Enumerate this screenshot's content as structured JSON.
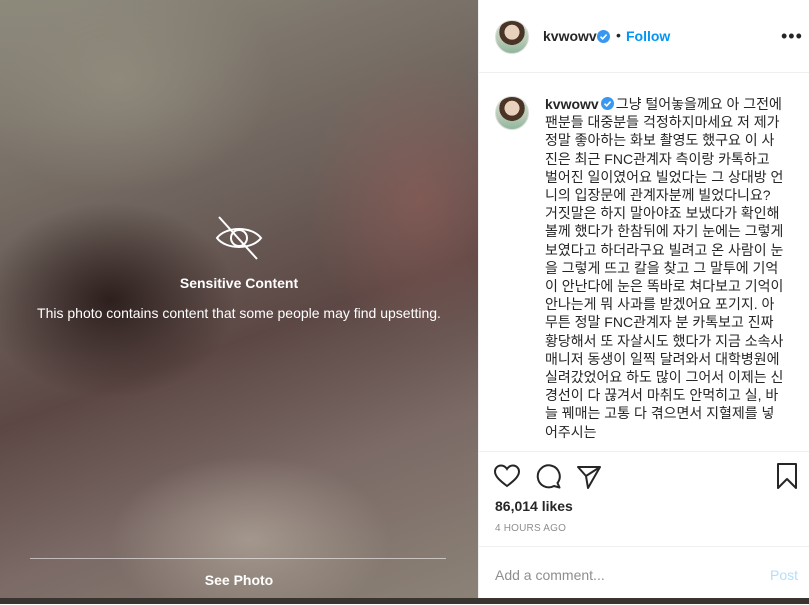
{
  "media": {
    "icon": "eye-slash-icon",
    "title": "Sensitive Content",
    "description": "This photo contains content that some people may find upsetting.",
    "see_photo": "See Photo"
  },
  "header": {
    "username": "kvwowv",
    "verified_icon": "verified-badge-icon",
    "separator": "•",
    "follow": "Follow",
    "more": "•••"
  },
  "caption": {
    "username": "kvwowv",
    "text": "그냥 털어놓을께요 아 그전에 팬분들 대중분들 걱정하지마세요 저 제가 정말 좋아하는 화보 촬영도 했구요 이 사진은 최근 FNC관계자 측이랑 카톡하고 벌어진 일이였어요 빌었다는 그 상대방 언니의 입장문에 관계자분께 빌었다니요? 거짓말은 하지 말아야죠 보냈다가 확인해볼께 했다가 한참뒤에 자기 눈에는 그렇게 보였다고 하더라구요 빌려고 온 사람이 눈을 그렇게 뜨고 칼을 찾고 그 말투에 기억이 안난다에 눈은 똑바로 쳐다보고 기억이 안나는게 뭐 사과를 받겠어요 포기지. 아무튼 정말 FNC관계자 분 카톡보고 진짜 황당해서 또 자살시도 했다가 지금 소속사 매니저 동생이 일찍 달려와서 대학병원에 실려갔었어요 하도 많이 그어서 이제는 신경선이 다 끊겨서 마취도 안먹히고 실, 바늘 꿰매는 고통 다 겪으면서 지혈제를 넣어주시는"
  },
  "actions": {
    "like_icon": "heart-icon",
    "comment_icon": "comment-icon",
    "share_icon": "paper-plane-icon",
    "save_icon": "bookmark-icon"
  },
  "likes": "86,014 likes",
  "timestamp": "4 HOURS AGO",
  "comment_box": {
    "placeholder": "Add a comment...",
    "post": "Post"
  },
  "colors": {
    "accent": "#0095f6",
    "post_disabled": "#b2dffc",
    "text": "#262626",
    "muted": "#8e8e8e"
  }
}
